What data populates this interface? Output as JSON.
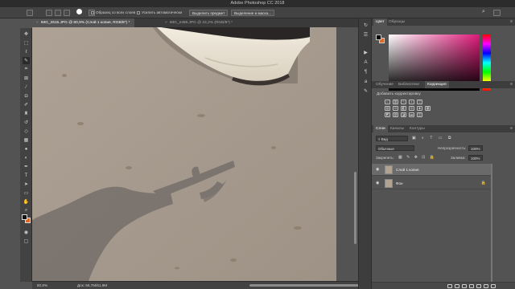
{
  "app": {
    "title": "Adobe Photoshop CC 2018"
  },
  "options_bar": {
    "sample_all_layers": "Образец со всех слоев",
    "auto_enhance": "Усилить автоматически",
    "select_subject": "Выделить предмет",
    "select_and_mask": "Выделение и маска..."
  },
  "document_tabs": [
    {
      "label": "IMG_2615.JPG @ 80,9% (Слой 1 копия, RGB/8*) *",
      "active": true
    },
    {
      "label": "IMG_2459.JPG @ 34,2% (RGB/8*) *",
      "active": false
    }
  ],
  "status": {
    "zoom": "80,9%",
    "doc": "Док: 66,7M/61,9M"
  },
  "color_panel": {
    "tabs": [
      "Цвет",
      "Образцы"
    ],
    "fg": "#000000",
    "bg": "#d8682a",
    "hue": "#e01a7a"
  },
  "adjustments_panel": {
    "tabs": [
      "Обучение",
      "Библиотеки",
      "Коррекция"
    ],
    "add_label": "Добавить корректировку"
  },
  "layers_panel": {
    "tabs": [
      "Слои",
      "Каналы",
      "Контуры"
    ],
    "filter_kind": "Вид",
    "blend_mode": "Обычные",
    "opacity_label": "Непрозрачность:",
    "opacity_value": "100%",
    "lock_label": "Закрепить:",
    "fill_label": "Заливка:",
    "fill_value": "100%",
    "layers": [
      {
        "name": "Слой 1 копия",
        "selected": true
      },
      {
        "name": "Фон",
        "selected": false,
        "locked": true
      }
    ]
  }
}
